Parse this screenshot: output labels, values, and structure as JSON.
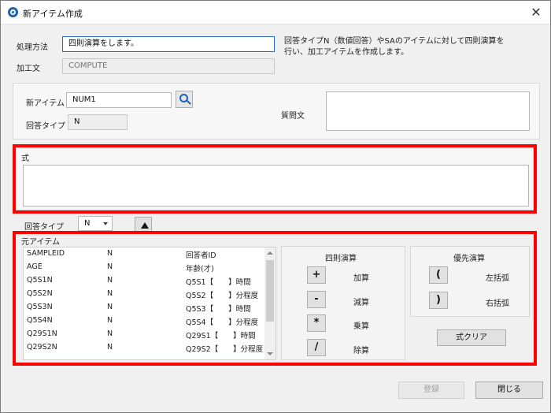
{
  "window": {
    "title": "新アイテム作成",
    "close_glyph": "✕"
  },
  "header": {
    "process_label": "処理方法",
    "process_value": "四則演算をします。",
    "description": "回答タイプN（数値回答）やSAのアイテムに対して四則演算を行い、加工アイテムを作成します。",
    "description_line1": "回答タイプN（数値回答）やSAのアイテムに対して四則演算を",
    "description_line2": "行い、加工アイテムを作成します。",
    "process_text_label": "加工文",
    "process_text_value": "COMPUTE"
  },
  "item": {
    "new_item_label": "新アイテム",
    "new_item_value": "NUM1",
    "answer_type_label": "回答タイプ",
    "answer_type_value": "N",
    "question_label": "質問文",
    "question_value": ""
  },
  "formula": {
    "label": "式",
    "value": ""
  },
  "answer_type_select": {
    "label": "回答タイプ",
    "value": "N"
  },
  "source": {
    "label": "元アイテム",
    "rows": [
      {
        "name": "SAMPLEID",
        "type": "N",
        "text": "回答者ID"
      },
      {
        "name": "AGE",
        "type": "N",
        "text": "年齢(才)"
      },
      {
        "name": "Q5S1N",
        "type": "N",
        "text": "Q5S1【　　】時間"
      },
      {
        "name": "Q5S2N",
        "type": "N",
        "text": "Q5S2【　　】分程度"
      },
      {
        "name": "Q5S3N",
        "type": "N",
        "text": "Q5S3【　　】時間"
      },
      {
        "name": "Q5S4N",
        "type": "N",
        "text": "Q5S4【　　】分程度"
      },
      {
        "name": "Q29S1N",
        "type": "N",
        "text": "Q29S1【　　】時間"
      },
      {
        "name": "Q29S2N",
        "type": "N",
        "text": "Q29S2【　　】分程度"
      }
    ]
  },
  "arithmetic": {
    "title": "四則演算",
    "ops": [
      {
        "symbol": "+",
        "label": "加算"
      },
      {
        "symbol": "-",
        "label": "減算"
      },
      {
        "symbol": "*",
        "label": "乗算"
      },
      {
        "symbol": "/",
        "label": "除算"
      }
    ]
  },
  "priority": {
    "title": "優先演算",
    "ops": [
      {
        "symbol": "(",
        "label": "左括弧"
      },
      {
        "symbol": ")",
        "label": "右括弧"
      }
    ],
    "clear_label": "式クリア"
  },
  "footer": {
    "register_label": "登録",
    "close_label": "閉じる"
  },
  "colors": {
    "highlight": "#ff0000",
    "accent": "#1d62b5"
  }
}
